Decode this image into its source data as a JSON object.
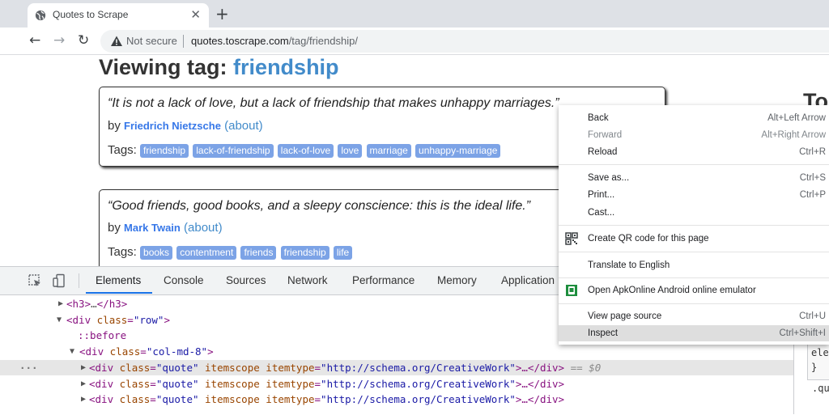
{
  "browser": {
    "tab_title": "Quotes to Scrape",
    "tab_close": "✕",
    "new_tab": "+",
    "back": "←",
    "forward": "→",
    "reload": "↻",
    "security_label": "Not secure",
    "url_host": "quotes.toscrape.com",
    "url_path": "/tag/friendship/"
  },
  "page": {
    "heading_prefix": "Viewing tag:",
    "heading_tag": "friendship",
    "side_heading": "To",
    "quotes": [
      {
        "text": "“It is not a lack of love, but a lack of friendship that makes unhappy marriages.”",
        "by": "by",
        "author": "Friedrich Nietzsche",
        "about": "(about)",
        "tags_label": "Tags:",
        "tags": [
          "friendship",
          "lack-of-friendship",
          "lack-of-love",
          "love",
          "marriage",
          "unhappy-marriage"
        ]
      },
      {
        "text": "“Good friends, good books, and a sleepy conscience: this is the ideal life.”",
        "by": "by",
        "author": "Mark Twain",
        "about": "(about)",
        "tags_label": "Tags:",
        "tags": [
          "books",
          "contentment",
          "friends",
          "friendship",
          "life"
        ]
      }
    ]
  },
  "devtools": {
    "tabs": [
      "Elements",
      "Console",
      "Sources",
      "Network",
      "Performance",
      "Memory",
      "Application"
    ],
    "active_tab": "Elements",
    "dom": {
      "h3_open": "<h3>",
      "h3_ellipsis": "…",
      "h3_close": "</h3>",
      "row_div": "<div ",
      "class_attr": "class",
      "row_value": "\"row\"",
      "before": "::before",
      "col_value": "\"col-md-8\"",
      "quote_value": "\"quote\"",
      "itemscope": "itemscope",
      "itemtype_attr": "itemtype",
      "itemtype_value": "\"http://schema.org/CreativeWork\"",
      "close_div": ">…</div>",
      "selected_suffix": "== $0",
      "ellipsis_dots": "···"
    },
    "styles_snippet_1": "ele",
    "styles_snippet_2": "}",
    "styles_snippet_3": ".qu"
  },
  "context_menu": {
    "items": [
      {
        "label": "Back",
        "shortcut": "Alt+Left Arrow",
        "disabled": false
      },
      {
        "label": "Forward",
        "shortcut": "Alt+Right Arrow",
        "disabled": true
      },
      {
        "label": "Reload",
        "shortcut": "Ctrl+R",
        "disabled": false
      },
      {
        "label": "Save as...",
        "shortcut": "Ctrl+S",
        "disabled": false
      },
      {
        "label": "Print...",
        "shortcut": "Ctrl+P",
        "disabled": false
      },
      {
        "label": "Cast...",
        "shortcut": "",
        "disabled": false
      },
      {
        "label": "Create QR code for this page",
        "shortcut": "",
        "icon": "qr-code-icon"
      },
      {
        "label": "Translate to English",
        "shortcut": ""
      },
      {
        "label": "Open ApkOnline Android online emulator",
        "shortcut": "",
        "icon": "apkonline-extension-icon"
      },
      {
        "label": "View page source",
        "shortcut": "Ctrl+U"
      },
      {
        "label": "Inspect",
        "shortcut": "Ctrl+Shift+I",
        "highlighted": true
      }
    ]
  },
  "colors": {
    "link": "#428bca",
    "tag_chip": "#7ca3e6",
    "devtools_accent": "#1a73e8",
    "menu_highlight": "#dedede"
  }
}
